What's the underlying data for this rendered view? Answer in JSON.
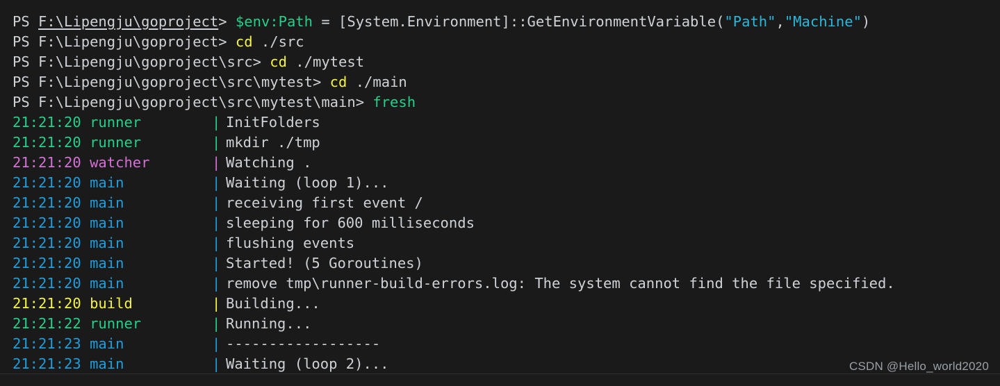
{
  "terminal": {
    "shell": "PowerShell",
    "background_color": "#1a1a1a",
    "default_text_color": "#cfd2d6",
    "colors": {
      "green": "#23d18b",
      "magenta": "#d670d6",
      "blue": "#1f9ede",
      "yellow": "#f5f543",
      "cyan": "#29b8db",
      "white": "#cfd2d6"
    },
    "prompt_lines": [
      {
        "ps": "PS",
        "path": "F:\\Lipengju\\goproject",
        "path_underlined": true,
        "caret": ">",
        "command_parts": [
          {
            "text": "$env:Path",
            "color": "green"
          },
          {
            "text": " = [System.Environment]::GetEnvironmentVariable(",
            "color": "white"
          },
          {
            "text": "\"Path\"",
            "color": "cyan"
          },
          {
            "text": ",",
            "color": "white"
          },
          {
            "text": "\"Machine\"",
            "color": "cyan"
          },
          {
            "text": ")",
            "color": "white"
          }
        ]
      },
      {
        "ps": "PS",
        "path": "F:\\Lipengju\\goproject",
        "path_underlined": false,
        "caret": ">",
        "command_parts": [
          {
            "text": "cd",
            "color": "yellow"
          },
          {
            "text": " ./src",
            "color": "white"
          }
        ]
      },
      {
        "ps": "PS",
        "path": "F:\\Lipengju\\goproject\\src",
        "path_underlined": false,
        "caret": ">",
        "command_parts": [
          {
            "text": "cd",
            "color": "yellow"
          },
          {
            "text": " ./mytest",
            "color": "white"
          }
        ]
      },
      {
        "ps": "PS",
        "path": "F:\\Lipengju\\goproject\\src\\mytest",
        "path_underlined": false,
        "caret": ">",
        "command_parts": [
          {
            "text": "cd",
            "color": "yellow"
          },
          {
            "text": " ./main",
            "color": "white"
          }
        ]
      },
      {
        "ps": "PS",
        "path": "F:\\Lipengju\\goproject\\src\\mytest\\main",
        "path_underlined": false,
        "caret": ">",
        "command_parts": [
          {
            "text": "fresh",
            "color": "green"
          }
        ]
      }
    ],
    "log_lines": [
      {
        "time": "21:21:20",
        "tag": "runner",
        "color": "green",
        "message": "InitFolders"
      },
      {
        "time": "21:21:20",
        "tag": "runner",
        "color": "green",
        "message": "mkdir ./tmp"
      },
      {
        "time": "21:21:20",
        "tag": "watcher",
        "color": "magenta",
        "message": "Watching ."
      },
      {
        "time": "21:21:20",
        "tag": "main",
        "color": "blue",
        "message": "Waiting (loop 1)..."
      },
      {
        "time": "21:21:20",
        "tag": "main",
        "color": "blue",
        "message": "receiving first event /"
      },
      {
        "time": "21:21:20",
        "tag": "main",
        "color": "blue",
        "message": "sleeping for 600 milliseconds"
      },
      {
        "time": "21:21:20",
        "tag": "main",
        "color": "blue",
        "message": "flushing events"
      },
      {
        "time": "21:21:20",
        "tag": "main",
        "color": "blue",
        "message": "Started! (5 Goroutines)"
      },
      {
        "time": "21:21:20",
        "tag": "main",
        "color": "blue",
        "message": "remove tmp\\runner-build-errors.log: The system cannot find the file specified."
      },
      {
        "time": "21:21:20",
        "tag": "build",
        "color": "yellow",
        "message": "Building..."
      },
      {
        "time": "21:21:22",
        "tag": "runner",
        "color": "green",
        "message": "Running..."
      },
      {
        "time": "21:21:23",
        "tag": "main",
        "color": "blue",
        "message": "------------------"
      },
      {
        "time": "21:21:23",
        "tag": "main",
        "color": "blue",
        "message": "Waiting (loop 2)..."
      }
    ],
    "separator_char": "|"
  },
  "watermark": {
    "text": "CSDN @Hello_world2020",
    "color": "#9aa0a6"
  }
}
